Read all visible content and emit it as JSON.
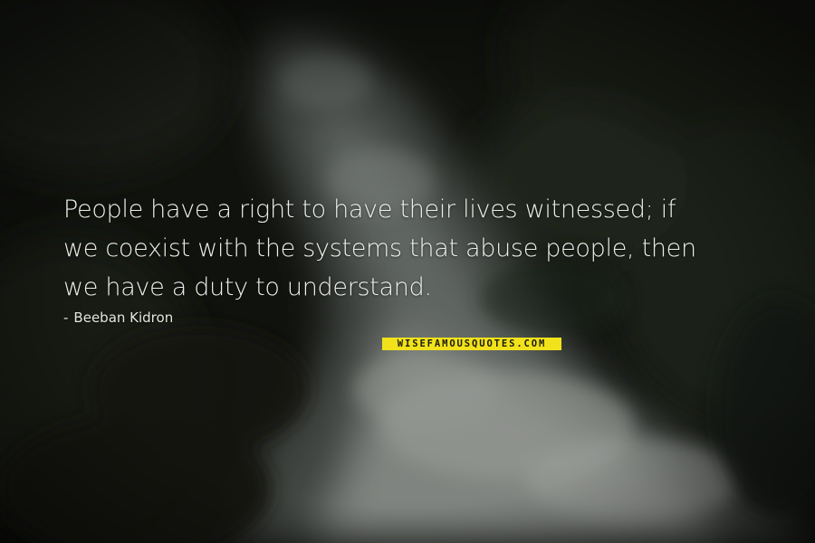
{
  "quote": {
    "lines": [
      "People have a right to have their lives witnessed; if",
      "we coexist with the systems that abuse people, then",
      "we have a duty to understand."
    ],
    "author_dash": "-",
    "author": "Beeban Kidron"
  },
  "watermark": {
    "text": "WISEFAMOUSQUOTES.COM",
    "background": "#f2e21b",
    "text_color": "#1b1b12"
  },
  "colors": {
    "background": "#151812",
    "quote_text": "#ecefe9",
    "waterfall": "#c9cec8"
  }
}
